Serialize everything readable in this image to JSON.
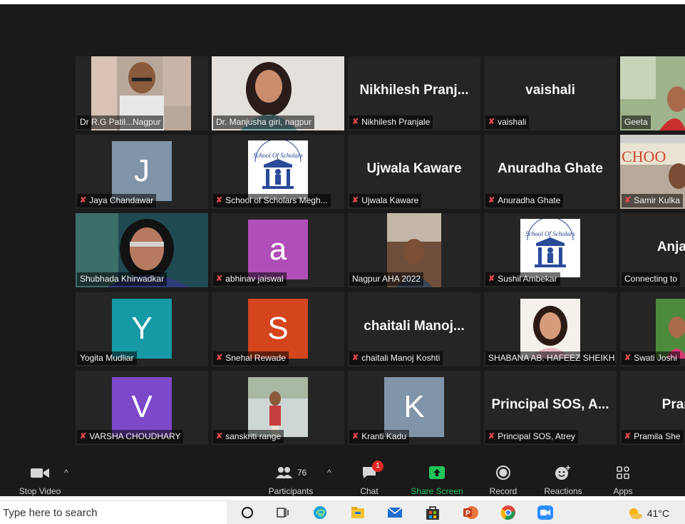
{
  "gallery": {
    "tiles": [
      {
        "id": "rg-patil",
        "name": "Dr R.G Patil...Nagpur",
        "muted": false,
        "kind": "video"
      },
      {
        "id": "manjusha",
        "name": "Dr. Manjusha giri, nagpur",
        "muted": false,
        "kind": "video"
      },
      {
        "id": "nikhilesh",
        "name": "Nikhilesh Pranjale",
        "display": "Nikhilesh Pranj...",
        "muted": true,
        "kind": "name"
      },
      {
        "id": "vaishali",
        "name": "vaishali",
        "display": "vaishali",
        "muted": true,
        "kind": "name"
      },
      {
        "id": "geeta",
        "name": "Geeta",
        "muted": false,
        "kind": "video"
      },
      {
        "id": "jaya",
        "name": "Jaya Chandawar",
        "letter": "J",
        "color": "#8095a8",
        "muted": true,
        "kind": "avatar"
      },
      {
        "id": "school-meghe",
        "name": "School of Scholars Megh...",
        "muted": true,
        "kind": "logo"
      },
      {
        "id": "ujwala",
        "name": "Ujwala Kaware",
        "display": "Ujwala Kaware",
        "muted": true,
        "kind": "name"
      },
      {
        "id": "anuradha",
        "name": "Anuradha Ghate",
        "display": "Anuradha Ghate",
        "muted": true,
        "kind": "name"
      },
      {
        "id": "samir",
        "name": "Samir Kulka",
        "muted": true,
        "kind": "video"
      },
      {
        "id": "shubhada",
        "name": "Shubhada Khirwadkar",
        "muted": false,
        "kind": "video",
        "active": true
      },
      {
        "id": "abhinav",
        "name": "abhinav jaiswal",
        "letter": "a",
        "color": "#b04fb8",
        "muted": true,
        "kind": "avatar"
      },
      {
        "id": "nagpur-aha",
        "name": "Nagpur AHA 2022",
        "muted": false,
        "kind": "video"
      },
      {
        "id": "sushil",
        "name": "Sushil Ambekar",
        "muted": true,
        "kind": "logo"
      },
      {
        "id": "anjali",
        "name": "Connecting to",
        "display": "Anjali Do",
        "muted": false,
        "kind": "name"
      },
      {
        "id": "yogita",
        "name": "Yogita Mudliar",
        "letter": "Y",
        "color": "#159aa6",
        "muted": false,
        "kind": "avatar"
      },
      {
        "id": "snehal",
        "name": "Snehal Rewade",
        "letter": "S",
        "color": "#d4451e",
        "muted": true,
        "kind": "avatar"
      },
      {
        "id": "chaitali",
        "name": "chaitali Manoj Koshti",
        "display": "chaitali Manoj...",
        "muted": true,
        "kind": "name"
      },
      {
        "id": "shabana",
        "name": "SHABANA AB. HAFEEZ SHEIKH",
        "muted": false,
        "kind": "video"
      },
      {
        "id": "swati",
        "name": "Swati Joshi",
        "muted": true,
        "kind": "video"
      },
      {
        "id": "varsha",
        "name": "VARSHA CHOUDHARY",
        "letter": "V",
        "color": "#7c47c9",
        "muted": true,
        "kind": "avatar"
      },
      {
        "id": "sanskriti",
        "name": "sanskriti range",
        "muted": true,
        "kind": "video"
      },
      {
        "id": "kranti",
        "name": "Kranti Kadu",
        "letter": "K",
        "color": "#8095a8",
        "muted": true,
        "kind": "avatar"
      },
      {
        "id": "principal",
        "name": "Principal SOS, Atrey",
        "display": "Principal SOS, A...",
        "muted": true,
        "kind": "name"
      },
      {
        "id": "pramila",
        "name": "Pramila She",
        "display": "Pramila",
        "muted": true,
        "kind": "name"
      }
    ]
  },
  "toolbar": {
    "stop_video": "Stop Video",
    "participants": "Participants",
    "participants_count": "76",
    "chat": "Chat",
    "chat_badge": "1",
    "share_screen": "Share Screen",
    "record": "Record",
    "reactions": "Reactions",
    "apps": "Apps"
  },
  "taskbar": {
    "search_placeholder": "Type here to search",
    "temperature": "41°C"
  },
  "colors": {
    "share_green": "#20c55b",
    "mute_red": "#e5484d",
    "active_border": "#cfe27a"
  }
}
